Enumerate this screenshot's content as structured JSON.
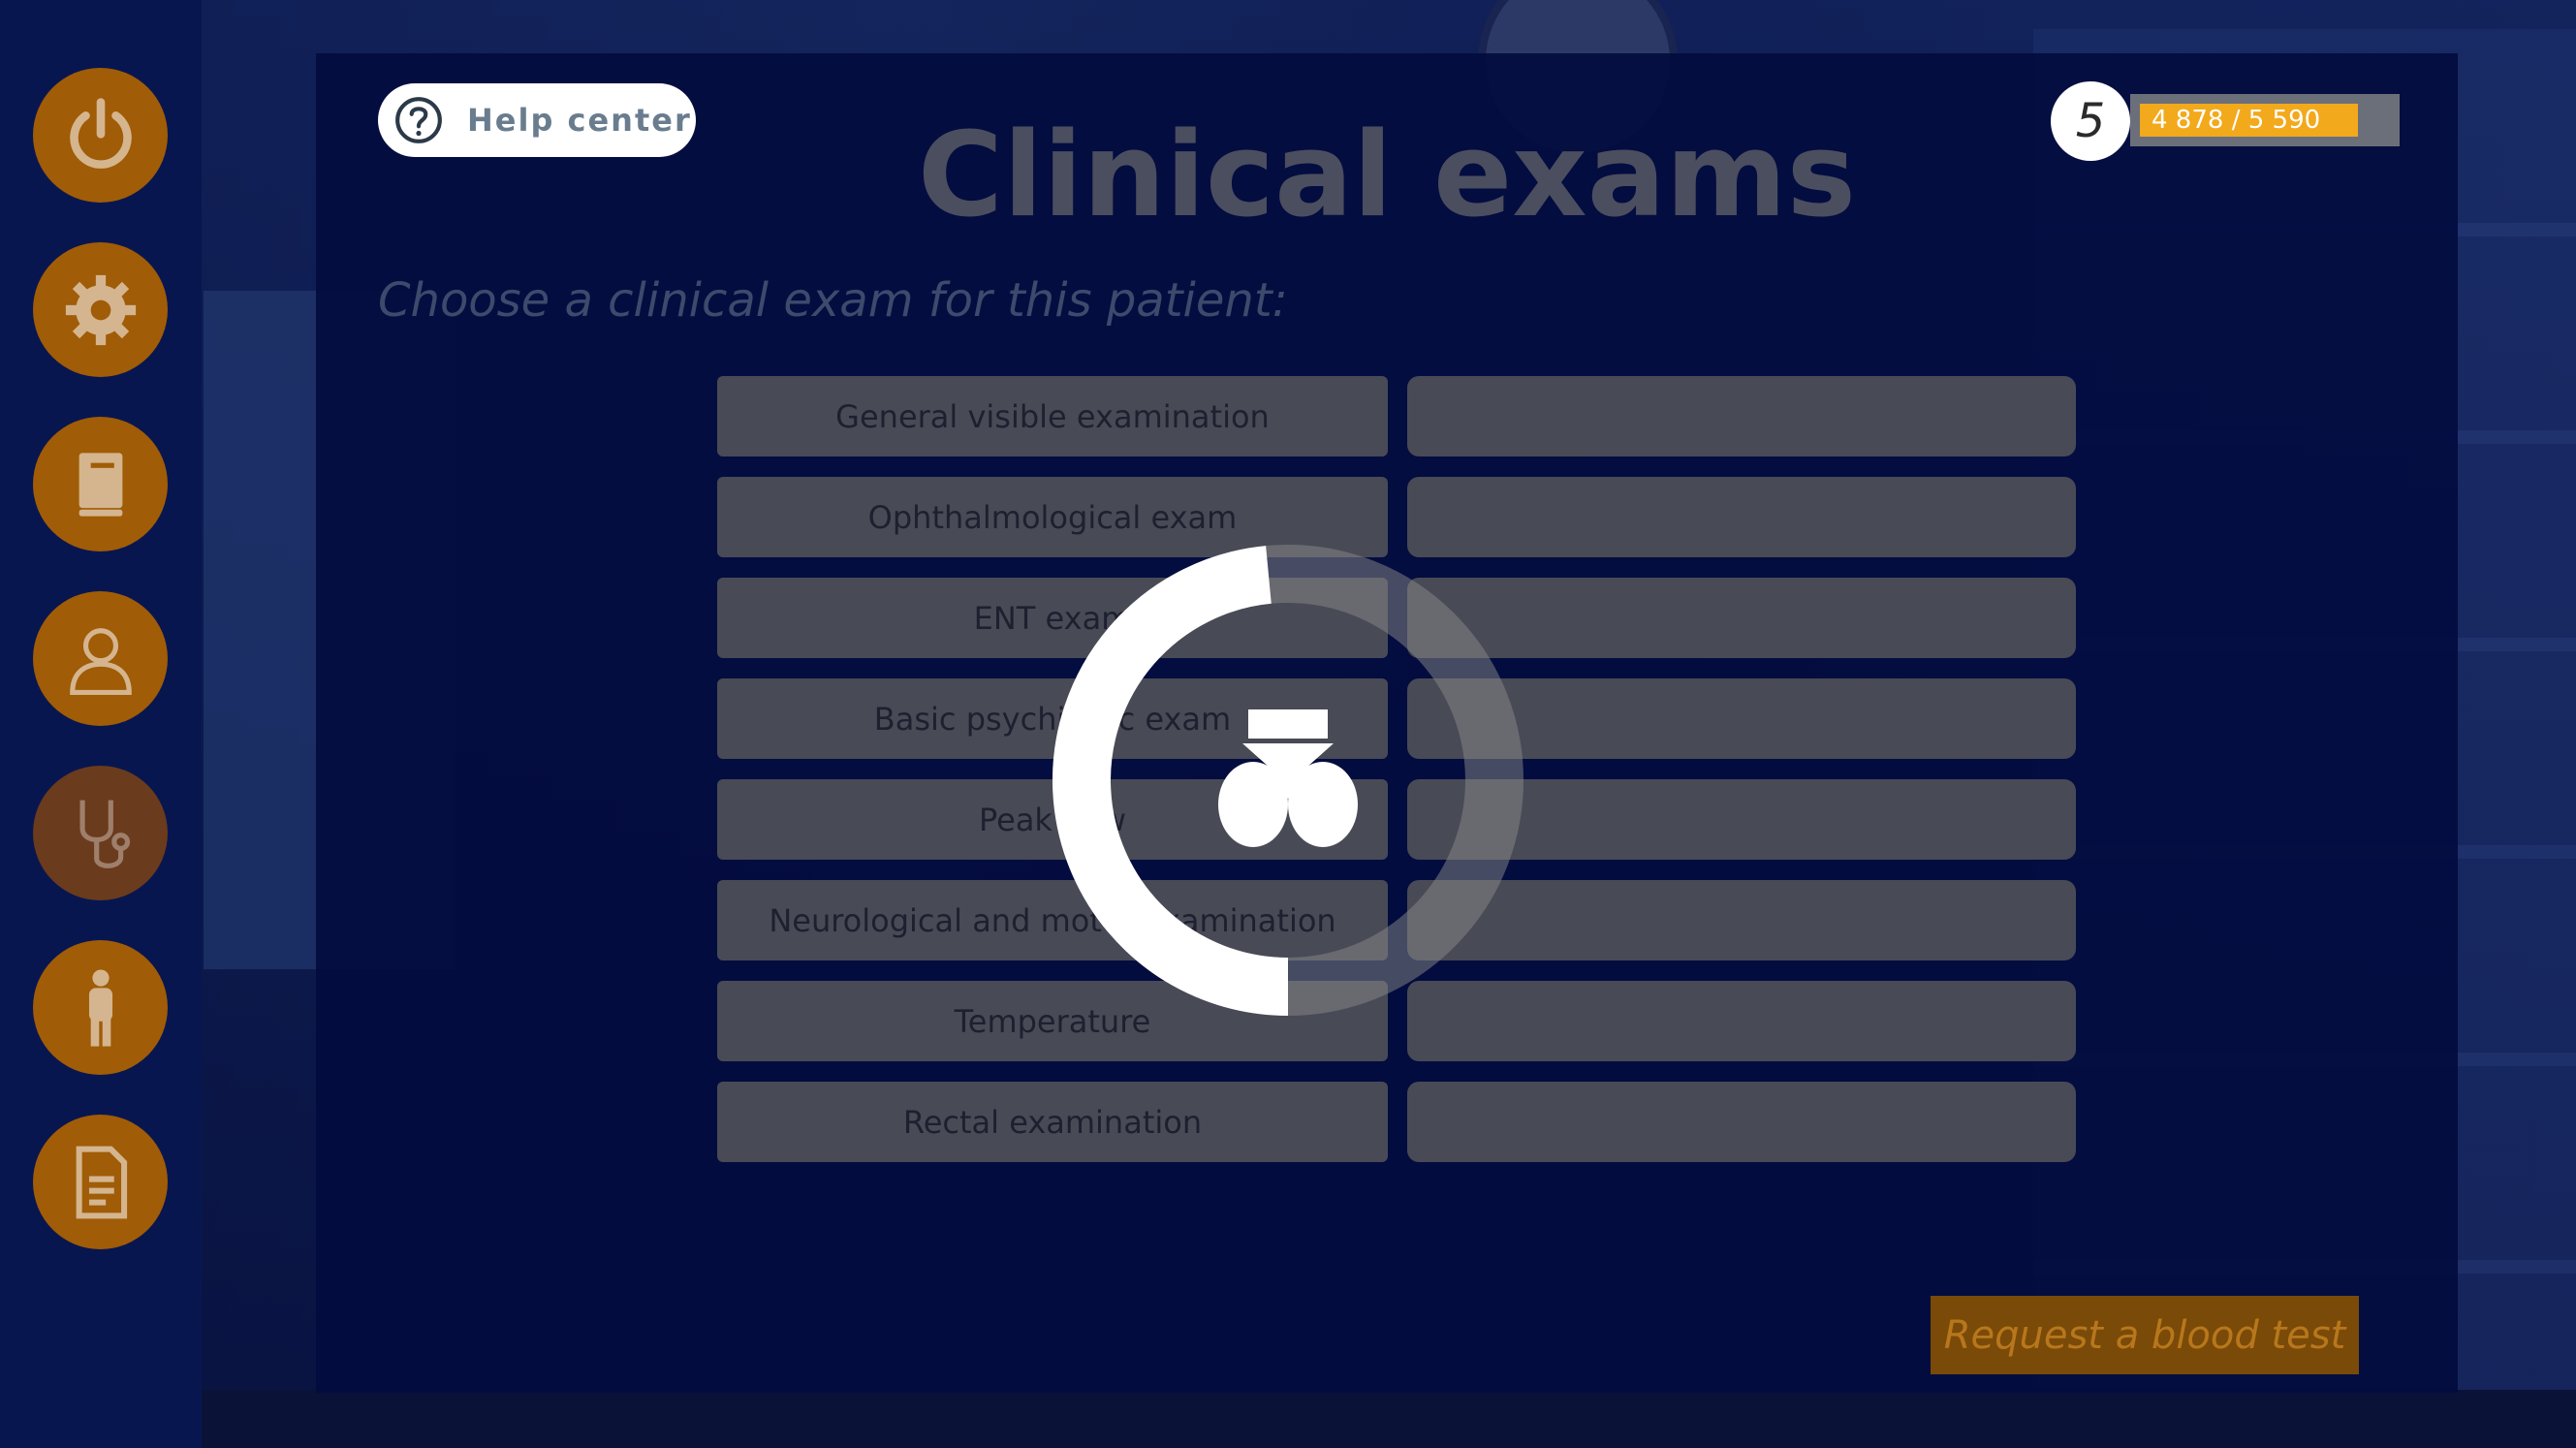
{
  "sidebar": {
    "buttons": [
      {
        "name": "power-icon"
      },
      {
        "name": "gear-icon"
      },
      {
        "name": "book-icon"
      },
      {
        "name": "person-icon"
      },
      {
        "name": "stethoscope-icon"
      },
      {
        "name": "body-icon"
      },
      {
        "name": "document-icon"
      }
    ]
  },
  "help": {
    "label": "Help center",
    "icon": "question-icon"
  },
  "header": {
    "title": "Clinical exams",
    "subtitle": "Choose a clinical exam for this patient:"
  },
  "player": {
    "level": "5",
    "xp_text": "4 878 / 5 590",
    "xp_fraction": 0.873
  },
  "exams": [
    {
      "label": "General visible examination",
      "result": ""
    },
    {
      "label": "Ophthalmological exam",
      "result": ""
    },
    {
      "label": "ENT exam",
      "result": ""
    },
    {
      "label": "Basic psychiatric exam",
      "result": ""
    },
    {
      "label": "Peak flow",
      "result": ""
    },
    {
      "label": "Neurological and motor examination",
      "result": ""
    },
    {
      "label": "Temperature",
      "result": ""
    },
    {
      "label": "Rectal examination",
      "result": ""
    }
  ],
  "footer": {
    "blood_test_label": "Request a blood test"
  },
  "loading": {
    "progress": 0.62,
    "icon": "nurse-icon"
  },
  "colors": {
    "sidebar_bg": "#081650",
    "sidebar_button": "#a05c06",
    "panel_bg": "#030c3e",
    "xp_fill": "#f2a91c",
    "spinner_track": "#8a8a8a",
    "spinner_arc": "#ffffff"
  }
}
